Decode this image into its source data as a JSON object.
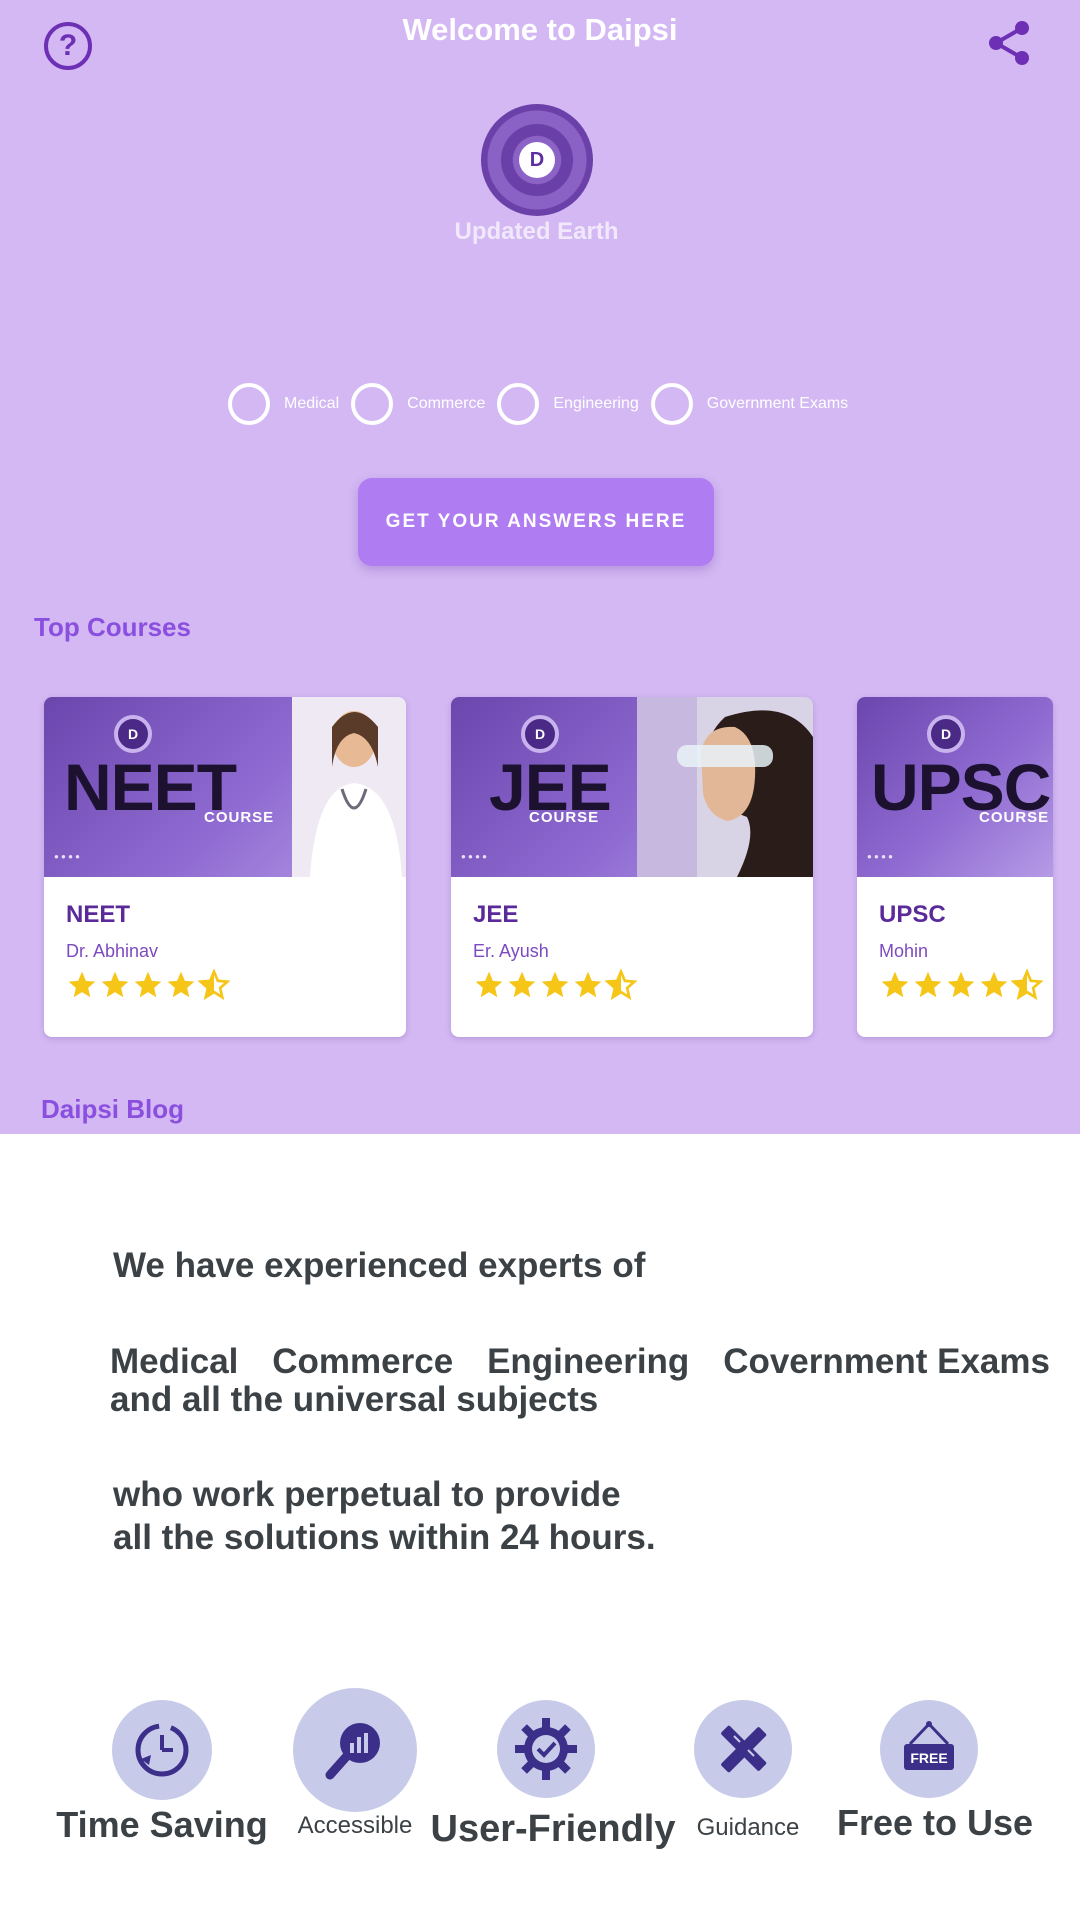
{
  "header": {
    "title": "Welcome to Daipsi",
    "help_icon": "question-circle-icon",
    "share_icon": "share-icon"
  },
  "profile": {
    "logo_glyph": "D",
    "caption": "Updated Earth"
  },
  "categories": [
    {
      "label": "Medical"
    },
    {
      "label": "Commerce"
    },
    {
      "label": "Engineering"
    },
    {
      "label": "Government Exams"
    }
  ],
  "cta": {
    "label": "GET YOUR ANSWERS HERE"
  },
  "top_courses": {
    "title": "Top Courses",
    "items": [
      {
        "banner_title": "NEET",
        "banner_sub": "COURSE",
        "title": "NEET",
        "instructor": "Dr. Abhinav",
        "rating": 4.5
      },
      {
        "banner_title": "JEE",
        "banner_sub": "COURSE",
        "title": "JEE",
        "instructor": "Er. Ayush",
        "rating": 4.5
      },
      {
        "banner_title": "UPSC",
        "banner_sub": "COURSE",
        "title": "UPSC",
        "instructor": "Mohin",
        "rating": 4.5
      }
    ]
  },
  "blog": {
    "title": "Daipsi Blog"
  },
  "info": {
    "heading": "We have experienced experts of",
    "subjects": [
      "Medical",
      "Commerce",
      "Engineering",
      "Covernment Exams"
    ],
    "subjects_line2": "and all the universal subjects",
    "line3": "who work perpetual to provide",
    "line4": "all the  solutions within 24 hours."
  },
  "features": [
    {
      "label": "Time Saving",
      "icon": "clock-icon"
    },
    {
      "label": "Accessible",
      "icon": "search-chart-icon"
    },
    {
      "label": "User-Friendly",
      "icon": "gear-check-icon"
    },
    {
      "label": "Guidance",
      "icon": "pencil-ruler-icon"
    },
    {
      "label": "Free to Use",
      "icon": "free-sign-icon",
      "badge": "FREE"
    }
  ],
  "colors": {
    "app_background": "#d3b8f3",
    "accent_purple": "#8b4fe0",
    "button": "#b07cf2",
    "text_dark": "#3b4145",
    "star": "#f5c518"
  }
}
